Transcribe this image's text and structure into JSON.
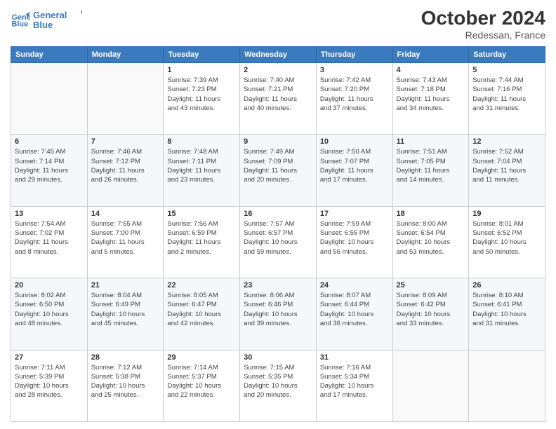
{
  "logo": {
    "line1": "General",
    "line2": "Blue"
  },
  "title": "October 2024",
  "location": "Redessan, France",
  "days_header": [
    "Sunday",
    "Monday",
    "Tuesday",
    "Wednesday",
    "Thursday",
    "Friday",
    "Saturday"
  ],
  "weeks": [
    [
      {
        "day": "",
        "info": ""
      },
      {
        "day": "",
        "info": ""
      },
      {
        "day": "1",
        "info": "Sunrise: 7:39 AM\nSunset: 7:23 PM\nDaylight: 11 hours\nand 43 minutes."
      },
      {
        "day": "2",
        "info": "Sunrise: 7:40 AM\nSunset: 7:21 PM\nDaylight: 11 hours\nand 40 minutes."
      },
      {
        "day": "3",
        "info": "Sunrise: 7:42 AM\nSunset: 7:20 PM\nDaylight: 11 hours\nand 37 minutes."
      },
      {
        "day": "4",
        "info": "Sunrise: 7:43 AM\nSunset: 7:18 PM\nDaylight: 11 hours\nand 34 minutes."
      },
      {
        "day": "5",
        "info": "Sunrise: 7:44 AM\nSunset: 7:16 PM\nDaylight: 11 hours\nand 31 minutes."
      }
    ],
    [
      {
        "day": "6",
        "info": "Sunrise: 7:45 AM\nSunset: 7:14 PM\nDaylight: 11 hours\nand 29 minutes."
      },
      {
        "day": "7",
        "info": "Sunrise: 7:46 AM\nSunset: 7:12 PM\nDaylight: 11 hours\nand 26 minutes."
      },
      {
        "day": "8",
        "info": "Sunrise: 7:48 AM\nSunset: 7:11 PM\nDaylight: 11 hours\nand 23 minutes."
      },
      {
        "day": "9",
        "info": "Sunrise: 7:49 AM\nSunset: 7:09 PM\nDaylight: 11 hours\nand 20 minutes."
      },
      {
        "day": "10",
        "info": "Sunrise: 7:50 AM\nSunset: 7:07 PM\nDaylight: 11 hours\nand 17 minutes."
      },
      {
        "day": "11",
        "info": "Sunrise: 7:51 AM\nSunset: 7:05 PM\nDaylight: 11 hours\nand 14 minutes."
      },
      {
        "day": "12",
        "info": "Sunrise: 7:52 AM\nSunset: 7:04 PM\nDaylight: 11 hours\nand 11 minutes."
      }
    ],
    [
      {
        "day": "13",
        "info": "Sunrise: 7:54 AM\nSunset: 7:02 PM\nDaylight: 11 hours\nand 8 minutes."
      },
      {
        "day": "14",
        "info": "Sunrise: 7:55 AM\nSunset: 7:00 PM\nDaylight: 11 hours\nand 5 minutes."
      },
      {
        "day": "15",
        "info": "Sunrise: 7:56 AM\nSunset: 6:59 PM\nDaylight: 11 hours\nand 2 minutes."
      },
      {
        "day": "16",
        "info": "Sunrise: 7:57 AM\nSunset: 6:57 PM\nDaylight: 10 hours\nand 59 minutes."
      },
      {
        "day": "17",
        "info": "Sunrise: 7:59 AM\nSunset: 6:55 PM\nDaylight: 10 hours\nand 56 minutes."
      },
      {
        "day": "18",
        "info": "Sunrise: 8:00 AM\nSunset: 6:54 PM\nDaylight: 10 hours\nand 53 minutes."
      },
      {
        "day": "19",
        "info": "Sunrise: 8:01 AM\nSunset: 6:52 PM\nDaylight: 10 hours\nand 50 minutes."
      }
    ],
    [
      {
        "day": "20",
        "info": "Sunrise: 8:02 AM\nSunset: 6:50 PM\nDaylight: 10 hours\nand 48 minutes."
      },
      {
        "day": "21",
        "info": "Sunrise: 8:04 AM\nSunset: 6:49 PM\nDaylight: 10 hours\nand 45 minutes."
      },
      {
        "day": "22",
        "info": "Sunrise: 8:05 AM\nSunset: 6:47 PM\nDaylight: 10 hours\nand 42 minutes."
      },
      {
        "day": "23",
        "info": "Sunrise: 8:06 AM\nSunset: 6:46 PM\nDaylight: 10 hours\nand 39 minutes."
      },
      {
        "day": "24",
        "info": "Sunrise: 8:07 AM\nSunset: 6:44 PM\nDaylight: 10 hours\nand 36 minutes."
      },
      {
        "day": "25",
        "info": "Sunrise: 8:09 AM\nSunset: 6:42 PM\nDaylight: 10 hours\nand 33 minutes."
      },
      {
        "day": "26",
        "info": "Sunrise: 8:10 AM\nSunset: 6:41 PM\nDaylight: 10 hours\nand 31 minutes."
      }
    ],
    [
      {
        "day": "27",
        "info": "Sunrise: 7:11 AM\nSunset: 5:39 PM\nDaylight: 10 hours\nand 28 minutes."
      },
      {
        "day": "28",
        "info": "Sunrise: 7:12 AM\nSunset: 5:38 PM\nDaylight: 10 hours\nand 25 minutes."
      },
      {
        "day": "29",
        "info": "Sunrise: 7:14 AM\nSunset: 5:37 PM\nDaylight: 10 hours\nand 22 minutes."
      },
      {
        "day": "30",
        "info": "Sunrise: 7:15 AM\nSunset: 5:35 PM\nDaylight: 10 hours\nand 20 minutes."
      },
      {
        "day": "31",
        "info": "Sunrise: 7:16 AM\nSunset: 5:34 PM\nDaylight: 10 hours\nand 17 minutes."
      },
      {
        "day": "",
        "info": ""
      },
      {
        "day": "",
        "info": ""
      }
    ]
  ]
}
